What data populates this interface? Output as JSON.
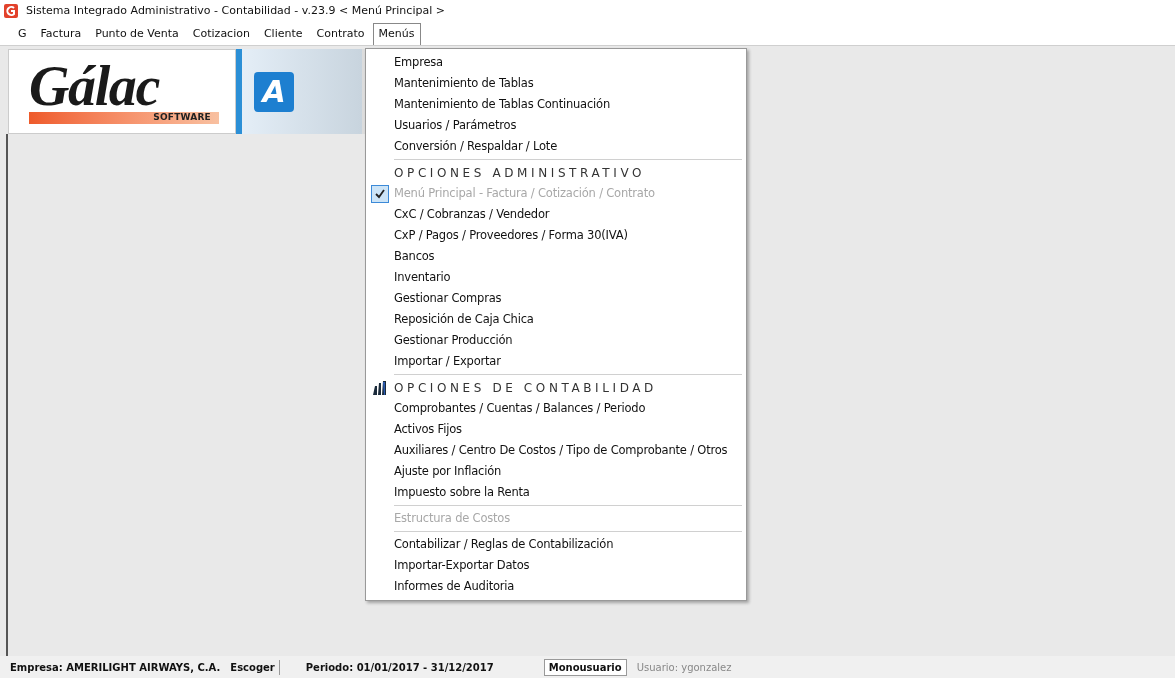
{
  "window": {
    "title": "Sistema Integrado Administrativo - Contabilidad - v.23.9 < Menú Principal >"
  },
  "menubar": [
    {
      "label": "G",
      "selected": false
    },
    {
      "label": "Factura",
      "selected": false
    },
    {
      "label": "Punto de Venta",
      "selected": false
    },
    {
      "label": "Cotizacion",
      "selected": false
    },
    {
      "label": "Cliente",
      "selected": false
    },
    {
      "label": "Contrato",
      "selected": false
    },
    {
      "label": "Menús",
      "selected": true
    }
  ],
  "banner": {
    "logo": "Gálac",
    "logo_sub": "SOFTWARE",
    "tile": "A"
  },
  "menu": [
    {
      "kind": "item",
      "label": "Empresa",
      "disabled": false,
      "checked": false
    },
    {
      "kind": "item",
      "label": "Mantenimiento de Tablas",
      "disabled": false,
      "checked": false
    },
    {
      "kind": "item",
      "label": "Mantenimiento de Tablas Continuación",
      "disabled": false,
      "checked": false
    },
    {
      "kind": "item",
      "label": "Usuarios / Parámetros",
      "disabled": false,
      "checked": false
    },
    {
      "kind": "item",
      "label": "Conversión / Respaldar / Lote",
      "disabled": false,
      "checked": false
    },
    {
      "kind": "separator"
    },
    {
      "kind": "header",
      "label": "OPCIONES ADMINISTRATIVO",
      "icon": false
    },
    {
      "kind": "item",
      "label": "Menú Principal - Factura / Cotización / Contrato",
      "disabled": true,
      "checked": true
    },
    {
      "kind": "item",
      "label": "CxC / Cobranzas / Vendedor",
      "disabled": false,
      "checked": false
    },
    {
      "kind": "item",
      "label": "CxP / Pagos / Proveedores / Forma 30(IVA)",
      "disabled": false,
      "checked": false
    },
    {
      "kind": "item",
      "label": "Bancos",
      "disabled": false,
      "checked": false
    },
    {
      "kind": "item",
      "label": "Inventario",
      "disabled": false,
      "checked": false
    },
    {
      "kind": "item",
      "label": "Gestionar Compras",
      "disabled": false,
      "checked": false
    },
    {
      "kind": "item",
      "label": "Reposición de Caja Chica",
      "disabled": false,
      "checked": false
    },
    {
      "kind": "item",
      "label": "Gestionar Producción",
      "disabled": false,
      "checked": false
    },
    {
      "kind": "item",
      "label": "Importar / Exportar",
      "disabled": false,
      "checked": false
    },
    {
      "kind": "separator"
    },
    {
      "kind": "header",
      "label": "OPCIONES DE CONTABILIDAD",
      "icon": true
    },
    {
      "kind": "item",
      "label": "Comprobantes / Cuentas / Balances / Periodo",
      "disabled": false,
      "checked": false
    },
    {
      "kind": "item",
      "label": "Activos Fijos",
      "disabled": false,
      "checked": false
    },
    {
      "kind": "item",
      "label": "Auxiliares / Centro De Costos / Tipo de Comprobante / Otros",
      "disabled": false,
      "checked": false
    },
    {
      "kind": "item",
      "label": "Ajuste por Inflación",
      "disabled": false,
      "checked": false
    },
    {
      "kind": "item",
      "label": "Impuesto sobre la Renta",
      "disabled": false,
      "checked": false
    },
    {
      "kind": "separator"
    },
    {
      "kind": "item",
      "label": "Estructura de Costos",
      "disabled": true,
      "checked": false
    },
    {
      "kind": "separator"
    },
    {
      "kind": "item",
      "label": "Contabilizar / Reglas de Contabilización",
      "disabled": false,
      "checked": false
    },
    {
      "kind": "item",
      "label": "Importar-Exportar Datos",
      "disabled": false,
      "checked": false
    },
    {
      "kind": "item",
      "label": "Informes de Auditoria",
      "disabled": false,
      "checked": false
    }
  ],
  "status_bar": {
    "empresa": "Empresa: AMERILIGHT AIRWAYS, C.A.",
    "escoger": "Escoger",
    "periodo": "Periodo: 01/01/2017 - 31/12/2017",
    "modo": "Monousuario",
    "usuario": "Usuario: ygonzalez"
  }
}
